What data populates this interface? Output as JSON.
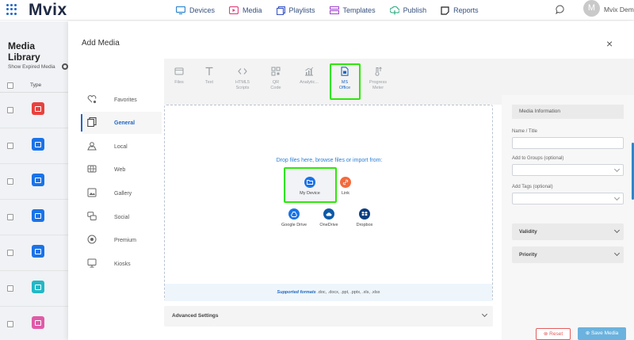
{
  "app": {
    "logo": "Mvix",
    "nav": [
      "Devices",
      "Media",
      "Playlists",
      "Templates",
      "Publish",
      "Reports"
    ],
    "user_initial": "M",
    "user_name": "Mvix Demo"
  },
  "library": {
    "title": "Media Library",
    "show_expired": "Show Expired Media",
    "type_header": "Type",
    "row_colors": [
      "#e8413e",
      "#1a73e8",
      "#1a73e8",
      "#1a73e8",
      "#1a73e8",
      "#22b8c7",
      "#e05aa8"
    ]
  },
  "modal": {
    "title": "Add Media",
    "close": "×",
    "menu": [
      {
        "label": "Favorites",
        "icon": "heart-star-icon",
        "active": false
      },
      {
        "label": "General",
        "icon": "copy-icon",
        "active": true
      },
      {
        "label": "Local",
        "icon": "location-icon",
        "active": false
      },
      {
        "label": "Web",
        "icon": "globe-icon",
        "active": false
      },
      {
        "label": "Gallery",
        "icon": "gallery-icon",
        "active": false
      },
      {
        "label": "Social",
        "icon": "chat-icon",
        "active": false
      },
      {
        "label": "Premium",
        "icon": "premium-icon",
        "active": false
      },
      {
        "label": "Kiosks",
        "icon": "kiosk-icon",
        "active": false
      }
    ],
    "types": [
      {
        "label": "Files"
      },
      {
        "label": "Text"
      },
      {
        "label": "HTML5\nScripts"
      },
      {
        "label": "QR\nCode"
      },
      {
        "label": "Analytic..."
      },
      {
        "label": "MS\nOffice"
      },
      {
        "label": "Progress\nMeter"
      }
    ],
    "drop_text": "Drop files here, browse files or import from:",
    "sources": [
      "My Device",
      "Link",
      "Google Drive",
      "OneDrive",
      "Dropbox"
    ],
    "formats_label": "Supported formats",
    "formats_value": ".doc, .docx, .ppt, .pptx, .xls, .xlsx",
    "advanced_settings": "Advanced Settings",
    "panel": {
      "info_title": "Media Information",
      "name_label": "Name / Title",
      "groups_label": "Add to Groups (optional)",
      "tags_label": "Add Tags (optional)",
      "validity": "Validity",
      "priority": "Priority",
      "reset": "Reset",
      "save": "Save Media"
    }
  },
  "colors": {
    "accent": "#2067c0",
    "highlight": "#2ee60c",
    "save_button": "#6bb2de",
    "reset_button": "#e45b5b"
  }
}
